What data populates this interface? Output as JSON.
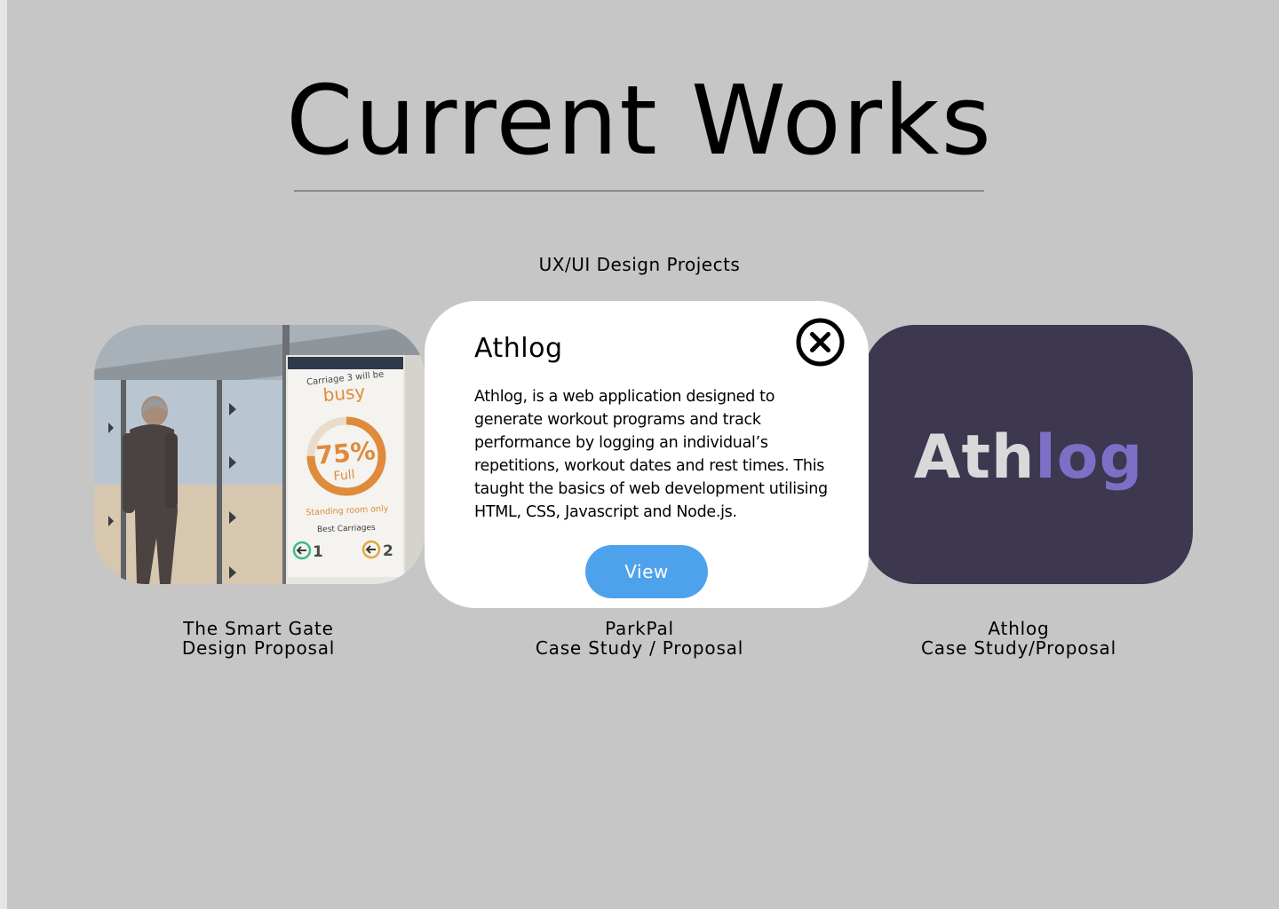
{
  "page": {
    "title": "Current Works",
    "section_label": "UX/UI Design Projects"
  },
  "projects": [
    {
      "line1": "The Smart Gate",
      "line2": "Design Proposal"
    },
    {
      "line1": "ParkPal",
      "line2": "Case Study / Proposal"
    },
    {
      "line1": "Athlog",
      "line2": "Case Study/Proposal"
    }
  ],
  "smartgate_image": {
    "sign_line1": "Carriage 3 will be",
    "sign_status": "busy",
    "sign_percent": "75%",
    "sign_full": "Full",
    "sign_standing": "Standing room only",
    "sign_best": "Best Carriages",
    "carriage_a": "1",
    "carriage_b": "2",
    "fill_level": 0.75
  },
  "athlog_logo": {
    "part1": "Ath",
    "part2": "log",
    "part1_color": "#d9d9d9",
    "part2_color": "#7c6fc6"
  },
  "modal": {
    "title": "Athlog",
    "description": "Athlog, is a web application designed to generate workout programs and track performance by logging an individual’s repetitions, workout dates and rest times. This taught the basics of web development utilising  HTML, CSS, Javascript and  Node.js.",
    "view_label": "View",
    "close_icon": "close-circle-icon"
  },
  "colors": {
    "background": "#c6c6c6",
    "button": "#4ea2ec",
    "athlog_card": "#3d3750"
  }
}
